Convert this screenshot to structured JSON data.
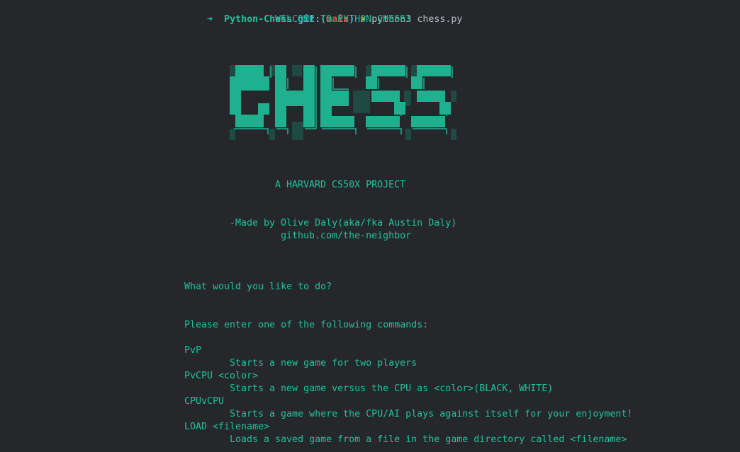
{
  "prompt": {
    "arrow": "➜",
    "directory": "Python-Chess",
    "git_label": "git:(",
    "branch": "main",
    "git_close": ")",
    "dirty_marker": "✗",
    "command": "python3 chess.py"
  },
  "welcome": "WELCOME TO PYTHON CHESS!",
  "logo_text": "CHESS",
  "subtitle": "A HARVARD CS50X PROJECT",
  "credit": "-Made by Olive Daly(aka/fka Austin Daly)",
  "github": "github.com/the-neighbor",
  "question": "What would you like to do?",
  "instructions": "Please enter one of the following commands:",
  "commands": [
    {
      "name": "PvP",
      "description": "Starts a new game for two players"
    },
    {
      "name": "PvCPU <color>",
      "description": "Starts a new game versus the CPU as <color>(BLACK, WHITE)"
    },
    {
      "name": "CPUvCPU",
      "description": "Starts a game where the CPU/AI plays against itself for your enjoyment!"
    },
    {
      "name": "LOAD <filename>",
      "description": "Loads a saved game from a file in the game directory called <filename>"
    }
  ],
  "colors": {
    "background": "#25272b",
    "text": "#1fc29c",
    "logo_fill": "#1fb08f",
    "logo_shadow": "#1f4a42",
    "branch": "#e0554d",
    "git": "#5aa7e0"
  }
}
